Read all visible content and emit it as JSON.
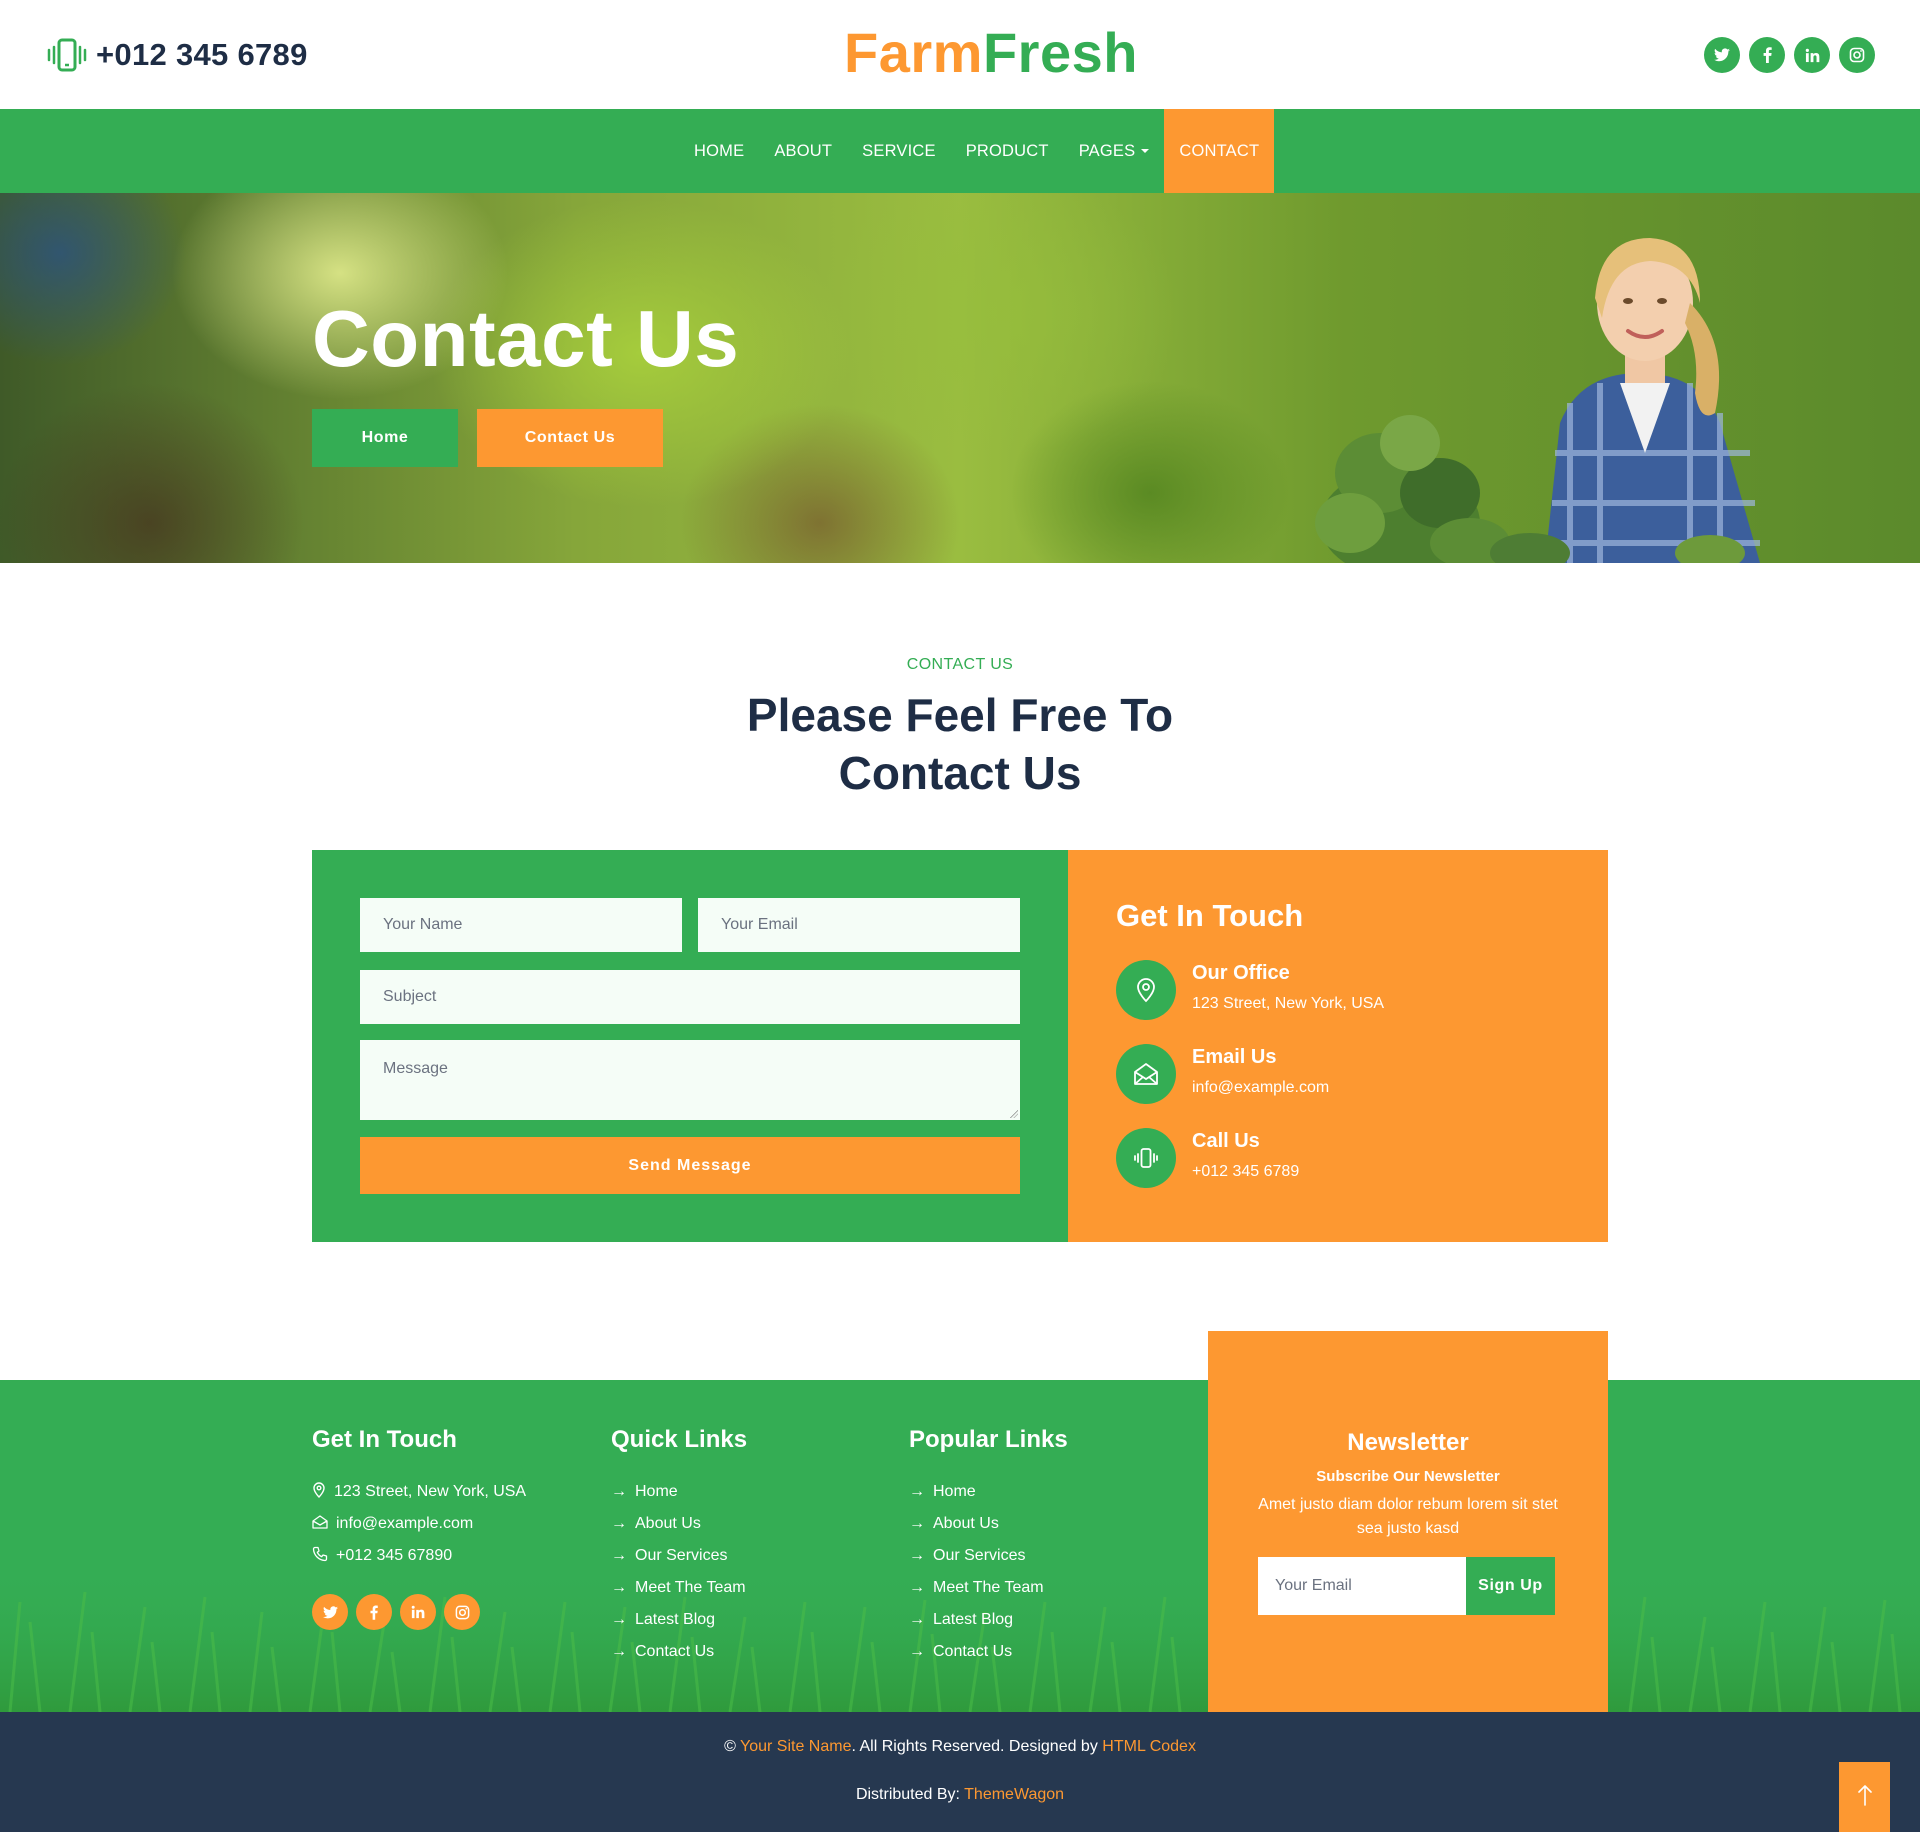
{
  "topbar": {
    "phone": "+012 345 6789",
    "phone_icon": "phone-vibrate-icon",
    "logo_part1": "Farm",
    "logo_part2": "Fresh",
    "social": [
      "twitter-icon",
      "facebook-icon",
      "linkedin-icon",
      "instagram-icon"
    ]
  },
  "nav": {
    "items": [
      {
        "label": "HOME"
      },
      {
        "label": "ABOUT"
      },
      {
        "label": "SERVICE"
      },
      {
        "label": "PRODUCT"
      },
      {
        "label": "PAGES"
      },
      {
        "label": "CONTACT"
      }
    ],
    "active": "CONTACT"
  },
  "hero": {
    "title": "Contact Us",
    "breadcrumb_home": "Home",
    "breadcrumb_current": "Contact Us"
  },
  "section": {
    "kicker": "CONTACT US",
    "title": "Please Feel Free To Contact Us"
  },
  "form": {
    "name_placeholder": "Your Name",
    "email_placeholder": "Your Email",
    "subject_placeholder": "Subject",
    "message_placeholder": "Message",
    "submit_label": "Send Message"
  },
  "contact_info": {
    "title": "Get In Touch",
    "items": [
      {
        "heading": "Our Office",
        "value": "123 Street, New York, USA",
        "icon": "map-pin-icon"
      },
      {
        "heading": "Email Us",
        "value": "info@example.com",
        "icon": "envelope-open-icon"
      },
      {
        "heading": "Call Us",
        "value": "+012 345 6789",
        "icon": "phone-vibrate-icon"
      }
    ]
  },
  "footer": {
    "touch": {
      "title": "Get In Touch",
      "address": "123 Street, New York, USA",
      "email": "info@example.com",
      "phone": "+012 345 67890"
    },
    "quick_links": {
      "title": "Quick Links",
      "items": [
        "Home",
        "About Us",
        "Our Services",
        "Meet The Team",
        "Latest Blog",
        "Contact Us"
      ]
    },
    "popular_links": {
      "title": "Popular Links",
      "items": [
        "Home",
        "About Us",
        "Our Services",
        "Meet The Team",
        "Latest Blog",
        "Contact Us"
      ]
    },
    "newsletter": {
      "title": "Newsletter",
      "subtitle": "Subscribe Our Newsletter",
      "description": "Amet justo diam dolor rebum lorem sit stet sea justo kasd",
      "input_placeholder": "Your Email",
      "button_label": "Sign Up"
    }
  },
  "copyright": {
    "prefix": "©",
    "site_name": "Your Site Name",
    "middle": ". All Rights Reserved. Designed by",
    "designer": "HTML Codex",
    "distributed_prefix": "Distributed By:",
    "distributor": "ThemeWagon"
  },
  "colors": {
    "green": "#34ad54",
    "orange": "#fd9831",
    "navy": "#1e2d45",
    "footer_dark": "#263850"
  }
}
